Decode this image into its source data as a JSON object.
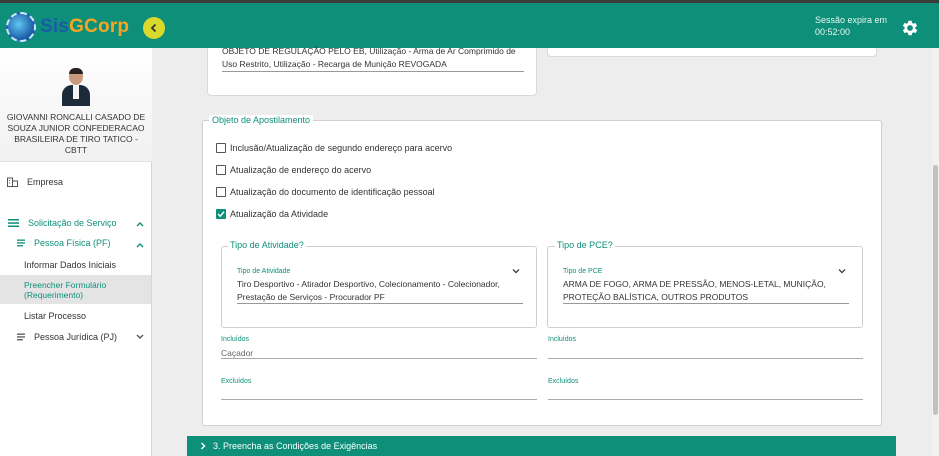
{
  "header": {
    "logo_part1": "Sis",
    "logo_part2": "GCorp",
    "session_label": "Sessão expira em",
    "session_time": "00:52:00"
  },
  "sidebar": {
    "profile_name": "GIOVANNI RONCALLI CASADO DE SOUZA JUNIOR CONFEDERACAO BRASILEIRA DE TIRO TATICO - CBTT",
    "items": {
      "empresa": "Empresa",
      "solicitacao": "Solicitação de Serviço",
      "pessoa_fisica": "Pessoa Física (PF)",
      "informar_dados": "Informar Dados Iniciais",
      "preencher_formulario": "Preencher Formulário (Requerimento)",
      "listar_processo": "Listar Processo",
      "pessoa_juridica": "Pessoa Jurídica (PJ)"
    }
  },
  "main": {
    "top_card_text": "OBJETO DE REGULAÇÃO PELO EB, Utilização - Arma de Ar Comprimido de Uso Restrito, Utilização - Recarga de Munição REVOGADA",
    "apostilamento": {
      "legend": "Objeto de Apostilamento",
      "options": [
        {
          "label": "Inclusão/Atualização de segundo endereço para acervo",
          "checked": false
        },
        {
          "label": "Atualização de endereço do acervo",
          "checked": false
        },
        {
          "label": "Atualização do documento de identificação pessoal",
          "checked": false
        },
        {
          "label": "Atualização da Atividade",
          "checked": true
        }
      ],
      "tipo_atividade": {
        "legend": "Tipo de Atividade?",
        "label": "Tipo de Atividade",
        "value": "Tiro Desportivo - Atirador Desportivo, Colecionamento - Colecionador, Prestação de Serviços - Procurador PF",
        "incluidos_label": "Incluídos",
        "incluidos_value": "Caçador",
        "excluidos_label": "Excluídos",
        "excluidos_value": ""
      },
      "tipo_pce": {
        "legend": "Tipo de PCE?",
        "label": "Tipo de PCE",
        "value": "ARMA DE FOGO, ARMA DE PRESSÃO, MENOS-LETAL, MUNIÇÃO, PROTEÇÃO BALÍSTICA, OUTROS PRODUTOS",
        "incluidos_label": "Incluídos",
        "incluidos_value": "",
        "excluidos_label": "Excluídos",
        "excluidos_value": ""
      }
    },
    "next_section": "3. Preencha as Condições de Exigências"
  },
  "colors": {
    "primary": "#0e8f7a",
    "accent_yellow": "#d9d92c"
  }
}
